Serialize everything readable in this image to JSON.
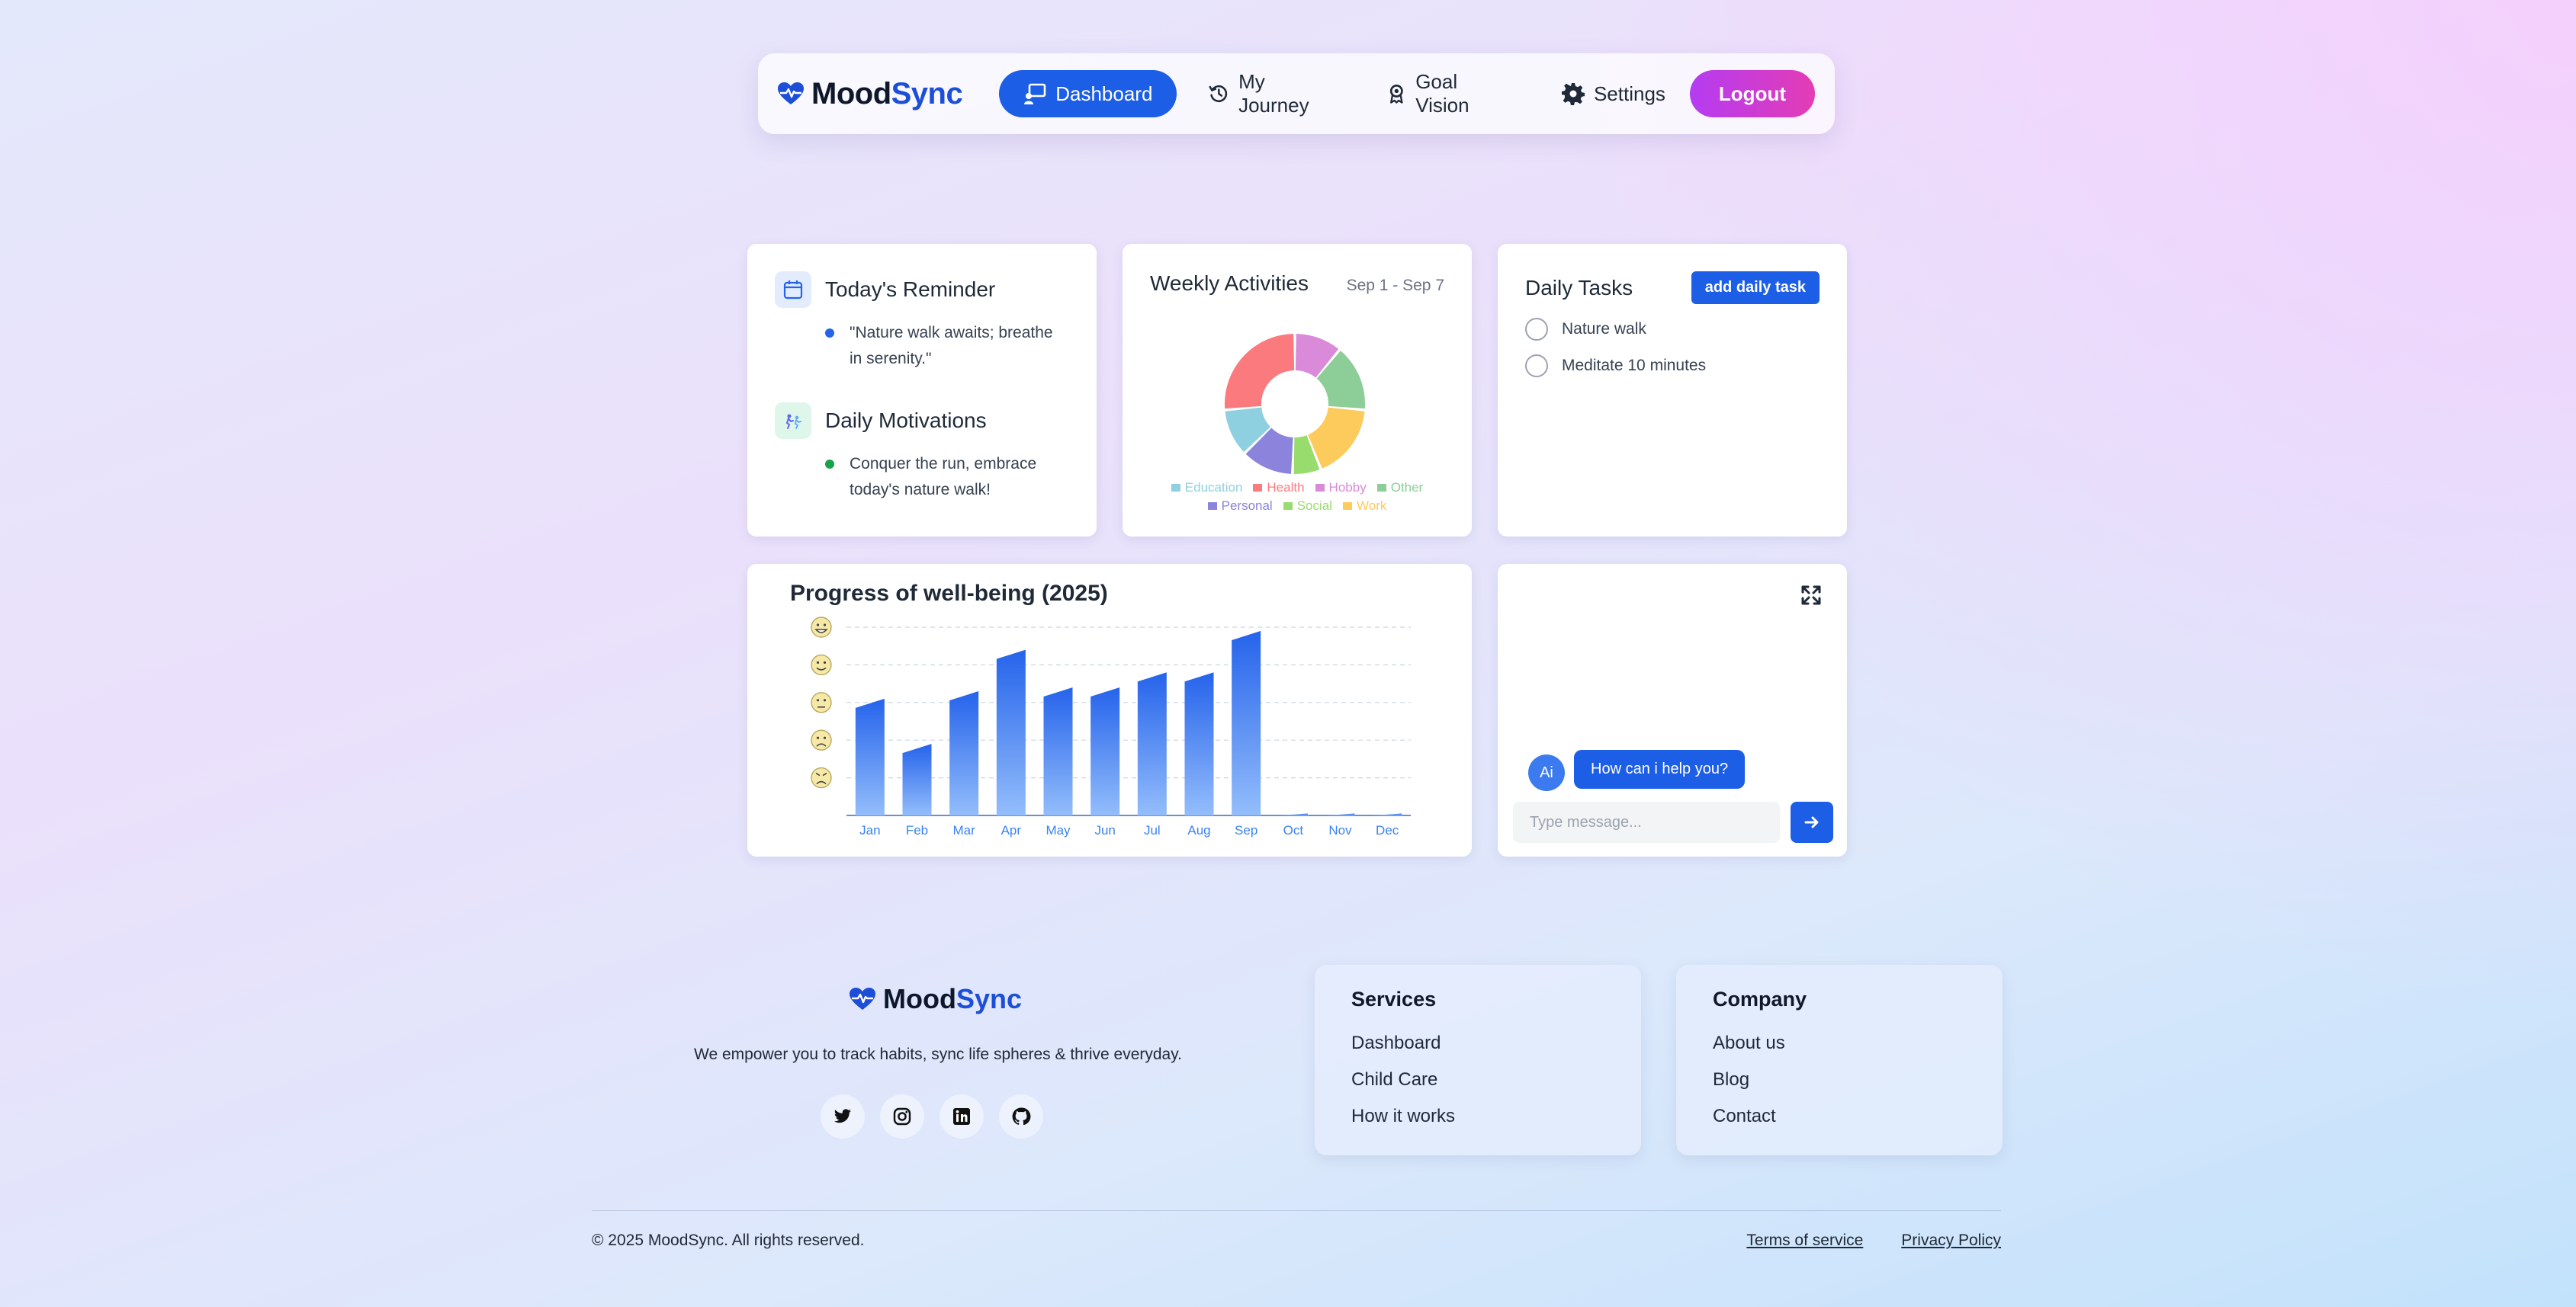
{
  "colors": {
    "primary": "#1d5ee6",
    "brand_dark": "#0f172a",
    "logout_from": "#b43cf2",
    "logout_to": "#e43cb4"
  },
  "nav": {
    "brand_part1": "Mood",
    "brand_part2": "Sync",
    "items": [
      {
        "label": "Dashboard",
        "icon": "dashboard-icon",
        "active": true
      },
      {
        "label": "My Journey",
        "icon": "history-icon",
        "active": false
      },
      {
        "label": "Goal Vision",
        "icon": "award-icon",
        "active": false
      },
      {
        "label": "Settings",
        "icon": "gear-icon",
        "active": false
      }
    ],
    "logout": "Logout"
  },
  "reminder": {
    "title": "Today's Reminder",
    "text": "\"Nature walk awaits; breathe in serenity.\"",
    "motivation_title": "Daily Motivations",
    "motivation_text": "Conquer the run, embrace today's nature walk!"
  },
  "weekly": {
    "title": "Weekly Activities",
    "date_range": "Sep 1 - Sep 7",
    "chart_data": {
      "type": "pie",
      "categories": [
        "Education",
        "Health",
        "Hobby",
        "Other",
        "Personal",
        "Social",
        "Work"
      ],
      "colors": [
        "#8fd0e0",
        "#fb7a7e",
        "#d98ad8",
        "#8ccd98",
        "#8b83dc",
        "#97dc6c",
        "#fdca5c"
      ],
      "values": [
        10,
        24,
        10,
        14,
        11,
        6,
        16
      ],
      "draw_order": [
        "Hobby",
        "Other",
        "Work",
        "Social",
        "Personal",
        "Education",
        "Health"
      ]
    }
  },
  "tasks": {
    "title": "Daily Tasks",
    "add_label": "add daily task",
    "items": [
      "Nature walk",
      "Meditate 10 minutes"
    ]
  },
  "progress": {
    "chart_data": {
      "type": "bar",
      "title": "Progress of well-being (2025)",
      "categories": [
        "Jan",
        "Feb",
        "Mar",
        "Apr",
        "May",
        "Jun",
        "Jul",
        "Aug",
        "Sep",
        "Oct",
        "Nov",
        "Dec"
      ],
      "values": [
        3.1,
        1.9,
        3.3,
        4.4,
        3.4,
        3.4,
        3.8,
        3.8,
        4.9,
        0.05,
        0.05,
        0.05
      ],
      "ylim": [
        0,
        5
      ],
      "y_icons": [
        "grinning-face-icon",
        "smiling-face-icon",
        "neutral-face-icon",
        "sad-face-icon",
        "angry-face-icon"
      ],
      "grid": true,
      "bar_color_top": "#2563eb",
      "bar_color_bottom": "#93bdfb"
    }
  },
  "chat": {
    "avatar": "Ai",
    "message": "How can i help you?",
    "placeholder": "Type message..."
  },
  "footer": {
    "brand_part1": "Mood",
    "brand_part2": "Sync",
    "tagline": "We empower you to track habits, sync life spheres & thrive everyday.",
    "socials": [
      "twitter-icon",
      "instagram-icon",
      "linkedin-icon",
      "github-icon"
    ],
    "services": {
      "title": "Services",
      "links": [
        "Dashboard",
        "Child Care",
        "How it works"
      ]
    },
    "company": {
      "title": "Company",
      "links": [
        "About us",
        "Blog",
        "Contact"
      ]
    },
    "copyright": "© 2025 MoodSync. All rights reserved.",
    "terms": "Terms of service",
    "privacy": "Privacy Policy"
  }
}
